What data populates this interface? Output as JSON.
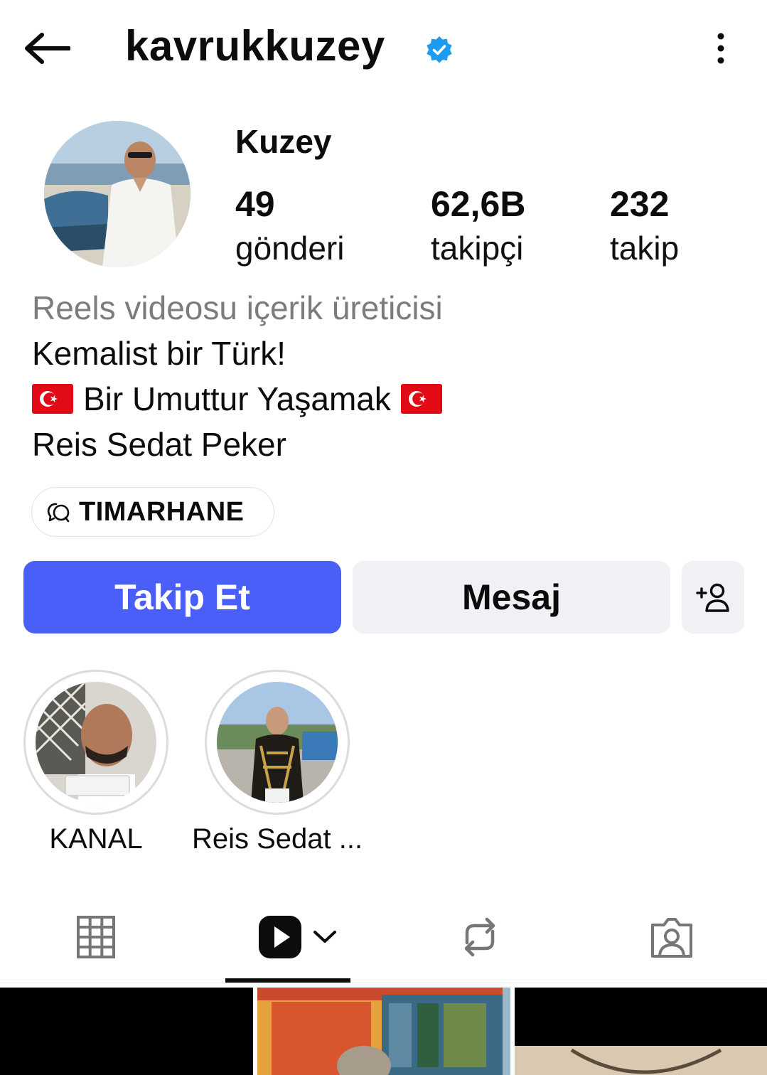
{
  "header": {
    "username": "kavrukkuzey",
    "verified_icon": "verified-badge-icon",
    "back_icon": "arrow-left-icon",
    "more_icon": "more-vertical-icon",
    "accent_verified": "#1d9bf0"
  },
  "profile": {
    "display_name": "Kuzey",
    "stats": [
      {
        "value": "49",
        "label": "gönderi"
      },
      {
        "value": "62,6B",
        "label": "takipçi"
      },
      {
        "value": "232",
        "label": "takip"
      }
    ],
    "bio": {
      "category": "Reels videosu içerik üreticisi",
      "line1": "Kemalist bir Türk!",
      "line2": "Bir Umuttur Yaşamak",
      "line3": "Reis Sedat Peker"
    },
    "channel_chip": {
      "label": "TIMARHANE",
      "icon": "broadcast-chat-icon"
    }
  },
  "actions": {
    "follow_label": "Takip Et",
    "message_label": "Mesaj",
    "add_user_icon": "add-person-icon",
    "follow_color": "#4a5ff7"
  },
  "highlights": [
    {
      "label": "KANAL"
    },
    {
      "label": "Reis Sedat ..."
    }
  ],
  "tabs": [
    {
      "icon": "grid-icon",
      "selected": false
    },
    {
      "icon": "reels-icon",
      "selected": true
    },
    {
      "icon": "reposts-icon",
      "selected": false
    },
    {
      "icon": "tagged-icon",
      "selected": false
    }
  ]
}
